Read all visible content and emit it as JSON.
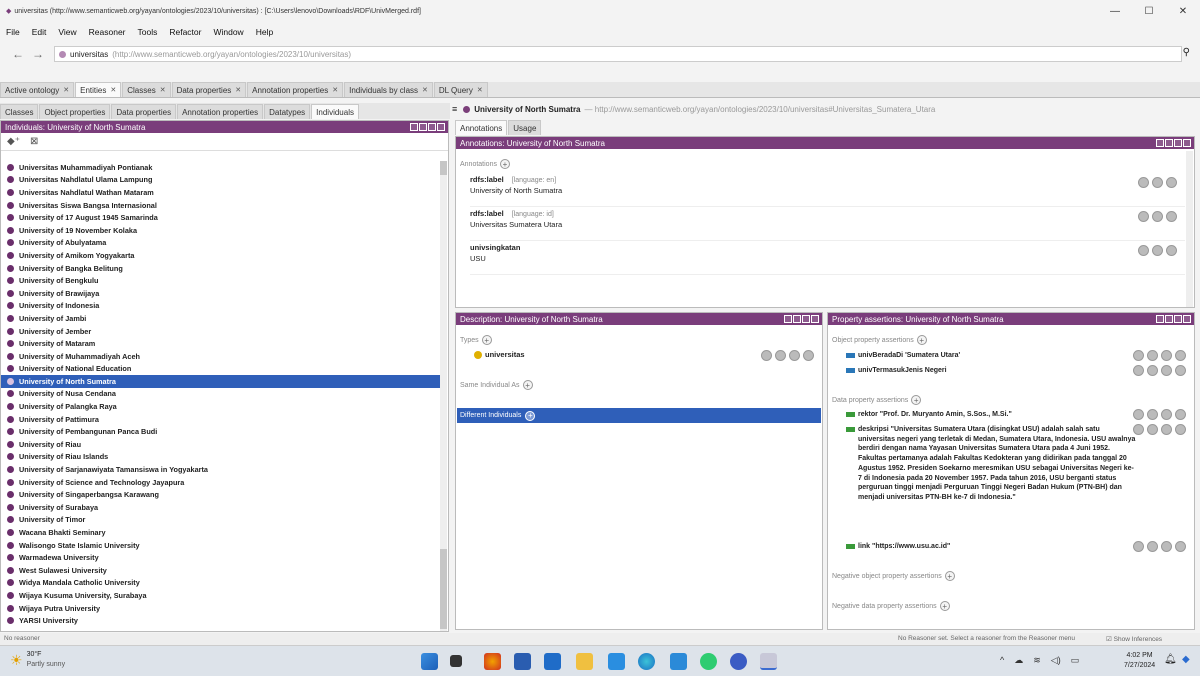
{
  "window": {
    "title": "universitas (http://www.semanticweb.org/yayan/ontologies/2023/10/universitas) : [C:\\Users\\lenovo\\Downloads\\RDF\\UnivMerged.rdf]"
  },
  "menu": [
    "File",
    "Edit",
    "View",
    "Reasoner",
    "Tools",
    "Refactor",
    "Window",
    "Help"
  ],
  "address": {
    "name": "universitas",
    "iri": "(http://www.semanticweb.org/yayan/ontologies/2023/10/universitas)"
  },
  "main_tabs": [
    {
      "label": "Active ontology",
      "active": false
    },
    {
      "label": "Entities",
      "active": true
    },
    {
      "label": "Classes",
      "active": false
    },
    {
      "label": "Data properties",
      "active": false
    },
    {
      "label": "Annotation properties",
      "active": false
    },
    {
      "label": "Individuals by class",
      "active": false
    },
    {
      "label": "DL Query",
      "active": false
    }
  ],
  "entity_tabs": [
    {
      "label": "Classes",
      "active": false
    },
    {
      "label": "Object properties",
      "active": false
    },
    {
      "label": "Data properties",
      "active": false
    },
    {
      "label": "Annotation properties",
      "active": false
    },
    {
      "label": "Datatypes",
      "active": false
    },
    {
      "label": "Individuals",
      "active": true
    }
  ],
  "left_panel": {
    "title": "Individuals: University of North Sumatra"
  },
  "individuals": [
    "Universitas Muhammadiyah Pontianak",
    "Universitas Nahdlatul Ulama Lampung",
    "Universitas Nahdlatul Wathan Mataram",
    "Universitas Siswa Bangsa Internasional",
    "University of 17 August 1945 Samarinda",
    "University of 19 November Kolaka",
    "University of Abulyatama",
    "University of Amikom Yogyakarta",
    "University of Bangka Belitung",
    "University of Bengkulu",
    "University of Brawijaya",
    "University of Indonesia",
    "University of Jambi",
    "University of Jember",
    "University of Mataram",
    "University of Muhammadiyah Aceh",
    "University of National Education",
    "University of North Sumatra",
    "University of Nusa Cendana",
    "University of Palangka Raya",
    "University of Pattimura",
    "University of Pembangunan Panca Budi",
    "University of Riau",
    "University of Riau Islands",
    "University of Sarjanawiyata Tamansiswa in Yogyakarta",
    "University of Science and Technology Jayapura",
    "University of Singaperbangsa Karawang",
    "University of Surabaya",
    "University of Timor",
    "Wacana Bhakti Seminary",
    "Walisongo State Islamic University",
    "Warmadewa University",
    "West Sulawesi University",
    "Widya Mandala Catholic University",
    "Wijaya Kusuma University, Surabaya",
    "Wijaya Putra University",
    "YARSI University"
  ],
  "selected_individual": "University of North Sumatra",
  "right_header": {
    "name": "University of North Sumatra",
    "iri": "— http://www.semanticweb.org/yayan/ontologies/2023/10/universitas#Universitas_Sumatera_Utara"
  },
  "right_tabs": [
    {
      "label": "Annotations",
      "active": true
    },
    {
      "label": "Usage",
      "active": false
    }
  ],
  "annotations_panel": {
    "title": "Annotations: University of North Sumatra",
    "label": "Annotations",
    "rows": [
      {
        "property": "rdfs:label",
        "lang": "[language: en]",
        "value": "University of North Sumatra"
      },
      {
        "property": "rdfs:label",
        "lang": "[language: id]",
        "value": "Universitas Sumatera Utara"
      },
      {
        "property": "univsingkatan",
        "lang": "",
        "value": "USU"
      }
    ]
  },
  "description_panel": {
    "title": "Description: University of North Sumatra",
    "types_label": "Types",
    "type_value": "universitas",
    "same_label": "Same Individual As",
    "different_label": "Different Individuals"
  },
  "property_panel": {
    "title": "Property assertions: University of North Sumatra",
    "object_label": "Object property assertions",
    "object_rows": [
      "univBeradaDi  'Sumatera Utara'",
      "univTermasukJenis  Negeri"
    ],
    "data_label": "Data property assertions",
    "data_rows": [
      "rektor  \"Prof. Dr. Muryanto Amin, S.Sos., M.Si.\"",
      "deskripsi  \"Universitas Sumatera Utara (disingkat USU) adalah salah satu universitas negeri yang terletak di Medan, Sumatera Utara, Indonesia. USU awalnya berdiri dengan nama Yayasan Universitas Sumatera Utara pada 4 Juni 1952. Fakultas pertamanya adalah Fakultas Kedokteran yang didirikan pada tanggal 20 Agustus 1952. Presiden Soekarno meresmikan USU sebagai Universitas Negeri ke-7 di Indonesia pada 20 November 1957. Pada tahun 2016, USU berganti status perguruan tinggi menjadi Perguruan Tinggi Negeri Badan Hukum (PTN-BH) dan menjadi universitas PTN-BH ke-7 di Indonesia.\"",
      "link  \"https://www.usu.ac.id\""
    ],
    "neg_object_label": "Negative object property assertions",
    "neg_data_label": "Negative data property assertions"
  },
  "status": {
    "left": "No reasoner",
    "right": "No Reasoner set. Select a reasoner from the Reasoner menu",
    "inferences": "Show Inferences"
  },
  "taskbar": {
    "weather_temp": "30°F",
    "weather_desc": "Partly sunny",
    "time": "4:02 PM",
    "date": "7/27/2024"
  },
  "colors": {
    "header": "#7a3d7b",
    "selected": "#2f5fb9"
  }
}
